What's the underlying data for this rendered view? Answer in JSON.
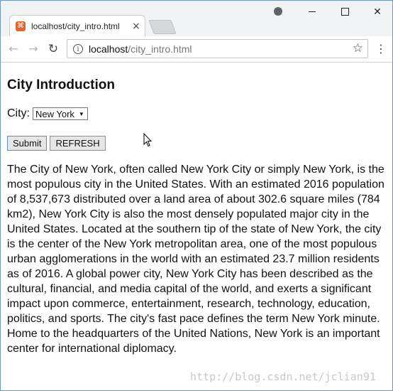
{
  "browser": {
    "tab_title": "localhost/city_intro.html",
    "tab_close": "×",
    "url_host": "localhost",
    "url_path": "/city_intro.html"
  },
  "page": {
    "title": "City Introduction",
    "city_label": "City:",
    "city_selected": "New York",
    "submit_label": "Submit",
    "refresh_label": "REFRESH",
    "description": "The City of New York, often called New York City or simply New York, is the most populous city in the United States. With an estimated 2016 population of 8,537,673 distributed over a land area of about 302.6 square miles (784 km2), New York City is also the most densely populated major city in the United States. Located at the southern tip of the state of New York, the city is the center of the New York metropolitan area, one of the most populous urban agglomerations in the world with an estimated 23.7 million residents as of 2016. A global power city, New York City has been described as the cultural, financial, and media capital of the world, and exerts a significant impact upon commerce, entertainment, research, technology, education, politics, and sports. The city's fast pace defines the term New York minute. Home to the headquarters of the United Nations, New York is an important center for international diplomacy."
  },
  "watermark": "http://blog.csdn.net/jclian91",
  "icons": [
    "favicon-icon",
    "close-tab-icon",
    "profile-icon",
    "minimize-icon",
    "maximize-icon",
    "close-window-icon",
    "back-icon",
    "forward-icon",
    "reload-icon",
    "info-icon",
    "star-icon",
    "menu-icon",
    "cursor-icon"
  ],
  "colors": {
    "favicon": "#e8632b",
    "window_border": "#6d95c8",
    "submit_focus": "#5a8bd6"
  }
}
